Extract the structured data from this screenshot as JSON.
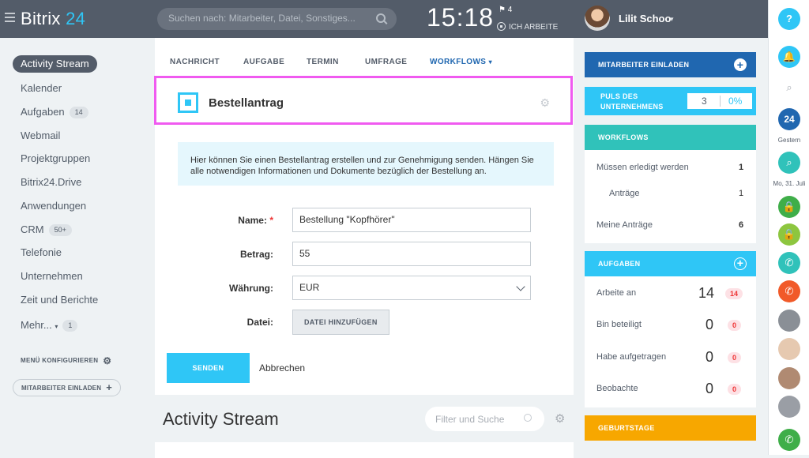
{
  "header": {
    "brand_name": "Bitrix",
    "brand_number": "24",
    "search_placeholder": "Suchen nach: Mitarbeiter, Datei, Sonstiges...",
    "time": "15:18",
    "flag_count": "4",
    "work_status": "ICH ARBEITE",
    "user_name": "Lilit Schoo"
  },
  "sidebar": {
    "items": [
      {
        "label": "Activity Stream"
      },
      {
        "label": "Kalender"
      },
      {
        "label": "Aufgaben",
        "badge": "14"
      },
      {
        "label": "Webmail"
      },
      {
        "label": "Projektgruppen"
      },
      {
        "label": "Bitrix24.Drive"
      },
      {
        "label": "Anwendungen"
      },
      {
        "label": "CRM",
        "badge": "50+"
      },
      {
        "label": "Telefonie"
      },
      {
        "label": "Unternehmen"
      },
      {
        "label": "Zeit und Berichte"
      },
      {
        "label": "Mehr...",
        "badge": "1"
      }
    ],
    "configure_menu": "MENÜ KONFIGURIEREN",
    "invite_button": "MITARBEITER EINLADEN"
  },
  "tabs": [
    "NACHRICHT",
    "AUFGABE",
    "TERMIN",
    "UMFRAGE",
    "WORKFLOWS"
  ],
  "form": {
    "title": "Bestellantrag",
    "info": "Hier können Sie einen Bestellantrag erstellen und zur Genehmigung senden. Hängen Sie alle notwendigen Informationen und Dokumente bezüglich der Bestellung an.",
    "name_label": "Name:",
    "name_value": "Bestellung \"Kopfhörer\"",
    "amount_label": "Betrag:",
    "amount_value": "55",
    "currency_label": "Währung:",
    "currency_value": "EUR",
    "file_label": "Datei:",
    "file_button": "DATEI HINZUFÜGEN",
    "send_button": "SENDEN",
    "cancel_link": "Abbrechen"
  },
  "stream": {
    "title": "Activity Stream",
    "filter_placeholder": "Filter und Suche"
  },
  "right": {
    "invite": "MITARBEITER EINLADEN",
    "pulse_label": "PULS DES UNTERNEHMENS",
    "pulse_value": "3",
    "pulse_percent": "0%",
    "workflows_title": "WORKFLOWS",
    "workflows": [
      {
        "label": "Müssen erledigt werden",
        "value": "1"
      },
      {
        "label": "Anträge",
        "value": "1"
      },
      {
        "label": "Meine Anträge",
        "value": "6"
      }
    ],
    "tasks_title": "AUFGABEN",
    "tasks": [
      {
        "label": "Arbeite an",
        "value": "14",
        "badge": "14"
      },
      {
        "label": "Bin beteiligt",
        "value": "0",
        "badge": "0"
      },
      {
        "label": "Habe aufgetragen",
        "value": "0",
        "badge": "0"
      },
      {
        "label": "Beobachte",
        "value": "0",
        "badge": "0"
      }
    ],
    "birthdays_title": "GEBURTSTAGE"
  },
  "rightbar": {
    "help": "?",
    "label_yesterday": "Gestern",
    "label_date": "Mo, 31. Juli",
    "badge_24": "24"
  },
  "colors": {
    "header_bg": "#535c69",
    "accent_blue": "#2fc6f6",
    "dark_blue": "#2067b0",
    "workflow_teal": "#30c2ba",
    "birthday_orange": "#f7a700",
    "highlight_border": "#f05af0"
  }
}
